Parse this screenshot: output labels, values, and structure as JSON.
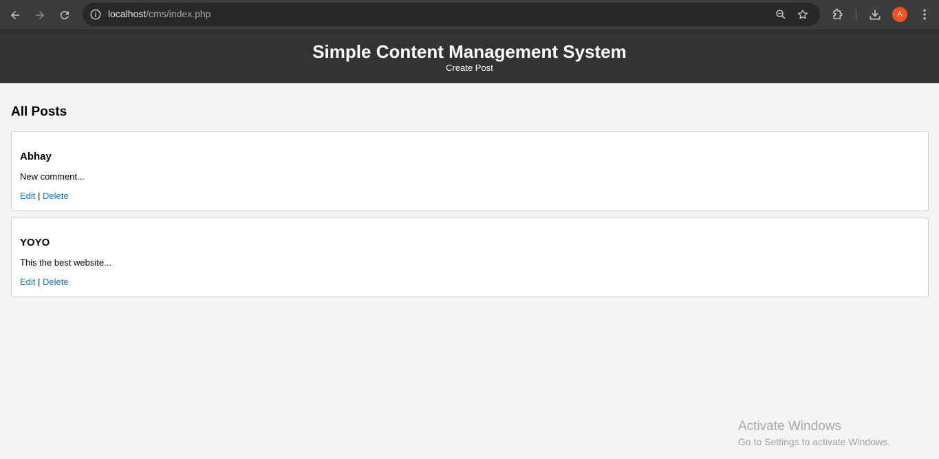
{
  "browser": {
    "url_host": "localhost",
    "url_path": "/cms/index.php",
    "avatar_initial": "A",
    "icons": {
      "back": "back-arrow-icon",
      "forward": "forward-arrow-icon",
      "reload": "reload-icon",
      "site_info": "info-icon",
      "zoom": "zoom-icon",
      "bookmark": "star-icon",
      "extensions": "puzzle-icon",
      "downloads": "download-icon",
      "menu": "kebab-menu-icon"
    },
    "avatar_color": "#f4511e"
  },
  "header": {
    "title": "Simple Content Management System",
    "nav_create": "Create Post",
    "bg_color": "#333333"
  },
  "main": {
    "section_title": "All Posts",
    "posts": [
      {
        "title": "Abhay",
        "excerpt": "New comment...",
        "edit_label": "Edit",
        "separator": "|",
        "delete_label": "Delete"
      },
      {
        "title": "YOYO",
        "excerpt": "This the best website...",
        "edit_label": "Edit",
        "separator": "|",
        "delete_label": "Delete"
      }
    ],
    "link_color": "#0b76d6"
  },
  "watermark": {
    "title": "Activate Windows",
    "subtitle": "Go to Settings to activate Windows."
  }
}
